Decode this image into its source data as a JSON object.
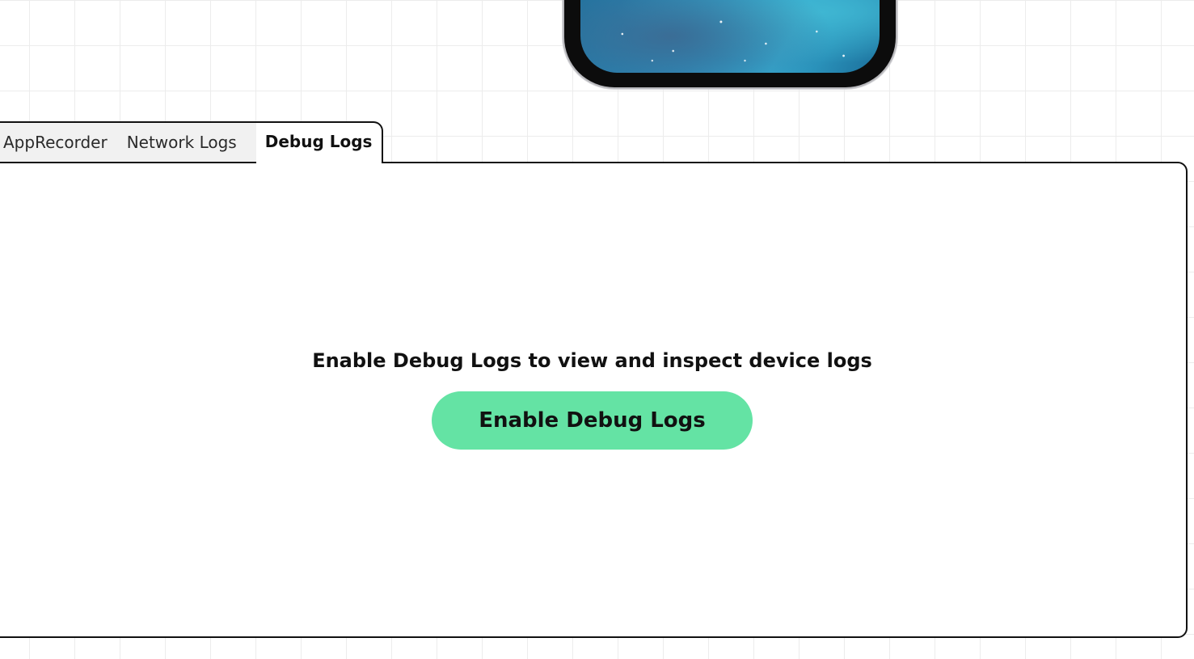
{
  "tabs": [
    {
      "label": "AppRecorder",
      "active": false
    },
    {
      "label": "Network Logs",
      "active": false
    },
    {
      "label": "Debug Logs",
      "active": true
    }
  ],
  "debug_panel": {
    "message": "Enable Debug Logs to view and inspect device logs",
    "button_label": "Enable Debug Logs"
  },
  "colors": {
    "button_bg": "#64e3a4",
    "border": "#111111",
    "inactive_tab_bg": "#f1f1f1"
  }
}
